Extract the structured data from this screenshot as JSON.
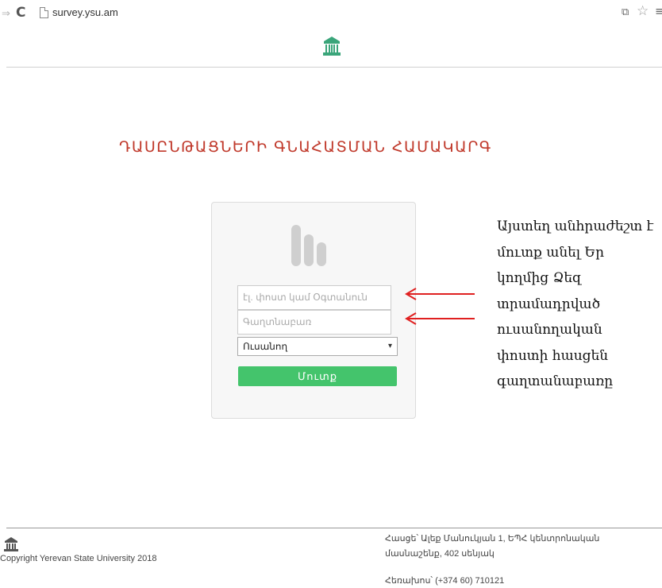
{
  "browser": {
    "forward_glyph": "⇒",
    "reload_glyph": "C",
    "url": "survey.ysu.am",
    "extension_glyph": "⧉",
    "star_glyph": "☆",
    "menu_glyph": "≡"
  },
  "header": {
    "logo_icon": "university-building-icon"
  },
  "page": {
    "title": "ԴԱՍԸՆԹԱՑՆԵՐԻ ԳՆԱՀԱՏՄԱՆ ՀԱՄԱԿԱՐԳ"
  },
  "login": {
    "logo_icon": "survey-bars-icon",
    "email_placeholder": "էլ. փոստ կամ Օգտանուն",
    "password_placeholder": "Գաղտնաբառ",
    "role_selected": "Ուսանող",
    "role_caret": "▾",
    "submit_label": "Մուտք",
    "button_color": "#44c46c"
  },
  "annotation": {
    "arrow_color": "#e02020",
    "lines": [
      "Այստեղ անհրաժեշտ է",
      "մուտք անել Եր",
      "կողմից Ձեզ",
      "տրամադրված",
      "ուսանողական",
      "փոստի հասցեն",
      "գաղտանաբառը"
    ]
  },
  "footer": {
    "copyright": "Copyright Yerevan State University 2018",
    "address": "Հասցե՝ Ալեք Մանուկյան 1, ԵՊՀ կենտրոնական մասնաշենք, 402 սենյակ",
    "phone": "Հեռախոս՝ (+374 60) 710121"
  },
  "colors": {
    "title": "#c0392b",
    "accent_green": "#44c46c",
    "arrow_red": "#e02020"
  }
}
